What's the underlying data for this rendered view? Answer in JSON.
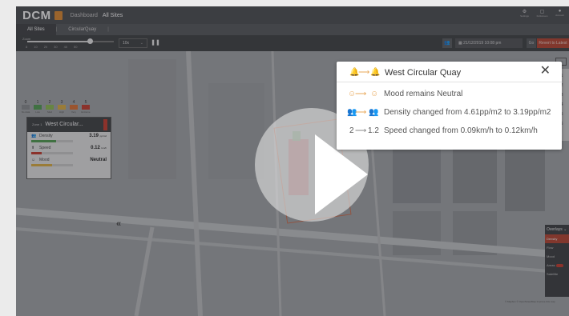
{
  "app": {
    "logo": "DCM",
    "breadcrumb_home": "Dashboard",
    "breadcrumb_current": "All Sites",
    "header_buttons": [
      {
        "icon": "gear-icon",
        "label": "Settings"
      },
      {
        "icon": "screen-icon",
        "label": "Fullscreen"
      },
      {
        "icon": "user-icon",
        "label": "Account"
      }
    ]
  },
  "tabs": [
    {
      "label": "All Sites",
      "active": true
    },
    {
      "label": "CircularQuay",
      "active": false
    }
  ],
  "controls": {
    "zoom_label": "Zoom",
    "speed_select": "10x",
    "pause_symbol": "❚❚",
    "datetime": "21/12/2019 10:08 pm",
    "goto_latest": "Revert to Latest",
    "zoom_level": 0.72,
    "ticks": [
      "8",
      "10",
      "20",
      "30",
      "40",
      "50"
    ]
  },
  "legend": [
    {
      "value": "0",
      "label": "No data",
      "color": "#8a8d90"
    },
    {
      "value": "1",
      "label": "Low",
      "color": "#4f9e4f"
    },
    {
      "value": "2",
      "label": "Med",
      "color": "#8fbf4f"
    },
    {
      "value": "3",
      "label": "High",
      "color": "#e0b040"
    },
    {
      "value": "4",
      "label": "Very",
      "color": "#e07030"
    },
    {
      "value": "5",
      "label": "Extreme",
      "color": "#c9392b"
    }
  ],
  "site_card": {
    "zone": "Zone 1",
    "title": "West Circular...",
    "metrics": [
      {
        "icon": "people-icon",
        "label": "Density",
        "value": "3.19",
        "unit": "pp/m2",
        "fill": 0.6,
        "color": "#4f9e4f"
      },
      {
        "icon": "speed-icon",
        "label": "Speed",
        "value": "0.12",
        "unit": "km/h",
        "fill": 0.25,
        "color": "#c9392b"
      },
      {
        "icon": "mood-icon",
        "label": "Mood",
        "value": "Neutral",
        "unit": "",
        "fill": 0.5,
        "color": "#e0b040"
      }
    ]
  },
  "overlays": {
    "title": "Overlays",
    "items": [
      {
        "label": "Density",
        "active": true
      },
      {
        "label": "Flow",
        "active": false
      },
      {
        "label": "Mood",
        "active": false
      },
      {
        "label": "Areas",
        "active": false
      },
      {
        "label": "Satellite",
        "active": false
      }
    ],
    "attribution": "© Mapbox © OpenStreetMap Improve this map"
  },
  "rail": [
    "1",
    "2",
    "3",
    "4",
    "5",
    "6"
  ],
  "notification": {
    "title": "West Circular Quay",
    "close_symbol": "✕",
    "rows": [
      {
        "from": "☺",
        "to": "☺",
        "from_color": "#e8a85a",
        "to_color": "#e8a85a",
        "text": "Mood remains Neutral"
      },
      {
        "from": "👥",
        "to": "👥",
        "from_color": "#e07a6a",
        "to_color": "#e8a85a",
        "text": "Density changed from 4.61pp/m2 to 3.19pp/m2"
      },
      {
        "from": "2",
        "to": "1.2",
        "from_color": "#555555",
        "to_color": "#555555",
        "text": "Speed changed from 0.09km/h to 0.12km/h"
      }
    ],
    "arrow": "⟶"
  }
}
